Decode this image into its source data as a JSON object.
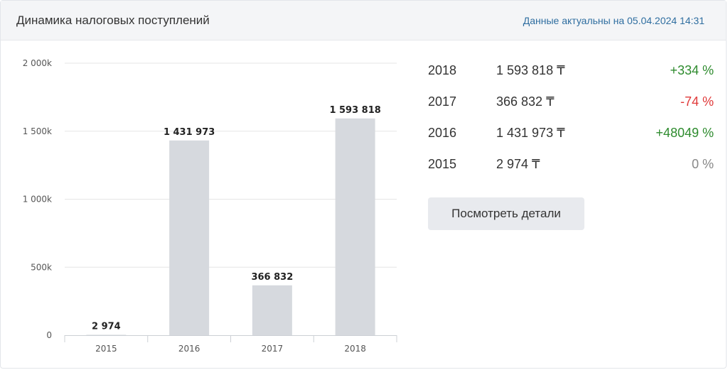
{
  "header": {
    "title": "Динамика налоговых поступлений",
    "updated": "Данные актуальны на 05.04.2024 14:31"
  },
  "chart_data": {
    "type": "bar",
    "categories": [
      "2015",
      "2016",
      "2017",
      "2018"
    ],
    "values": [
      2974,
      1431973,
      366832,
      1593818
    ],
    "value_labels": [
      "2 974",
      "1 431 973",
      "366 832",
      "1 593 818"
    ],
    "y_ticks": [
      {
        "value": 0,
        "label": "0"
      },
      {
        "value": 500000,
        "label": "500k"
      },
      {
        "value": 1000000,
        "label": "1 000k"
      },
      {
        "value": 1500000,
        "label": "1 500k"
      },
      {
        "value": 2000000,
        "label": "2 000k"
      }
    ],
    "ylim": [
      0,
      2000000
    ],
    "grid": true,
    "bar_color": "#d6d9de"
  },
  "stats": [
    {
      "year": "2018",
      "value": "1 593 818 ₸",
      "change": "+334 %",
      "trend": "pos"
    },
    {
      "year": "2017",
      "value": "366 832 ₸",
      "change": "-74 %",
      "trend": "neg"
    },
    {
      "year": "2016",
      "value": "1 431 973 ₸",
      "change": "+48049 %",
      "trend": "pos"
    },
    {
      "year": "2015",
      "value": "2 974 ₸",
      "change": "0 %",
      "trend": "zero"
    }
  ],
  "details_button": "Посмотреть детали",
  "colors": {
    "positive": "#2e8b2e",
    "negative": "#e03a3a",
    "neutral": "#888888",
    "link": "#2f6ea0"
  }
}
